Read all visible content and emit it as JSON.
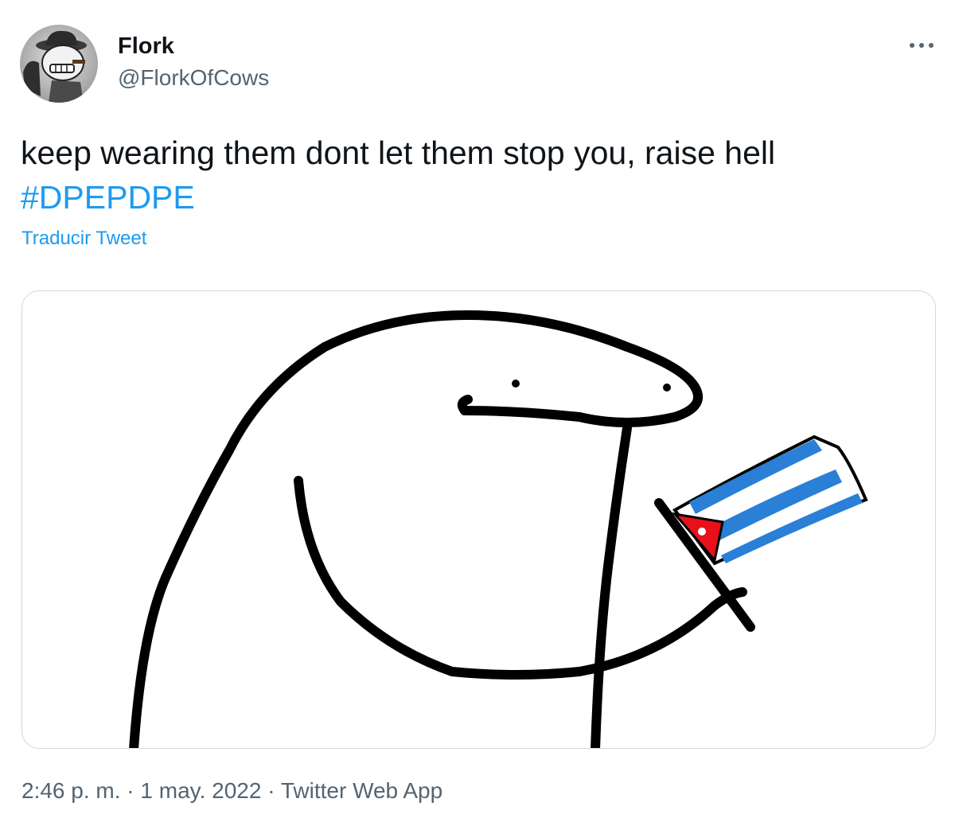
{
  "tweet": {
    "author": {
      "name": "Flork",
      "handle": "@FlorkOfCows"
    },
    "text": "keep wearing them dont let them stop you, raise hell",
    "hashtag": "#DPEPDPE",
    "translate_label": "Traducir Tweet",
    "more_label": "···",
    "meta": {
      "time": "2:46 p. m.",
      "separator": " · ",
      "date": "1 may. 2022",
      "source": "Twitter Web App"
    }
  },
  "colors": {
    "link": "#1d9bf0",
    "secondary_text": "#536471",
    "primary_text": "#0f1419",
    "border": "#cfd9de",
    "flag_blue": "#2a7fd6",
    "flag_red": "#e8111b"
  },
  "icons": {
    "more": "more-horizontal-icon",
    "avatar": "avatar-image"
  }
}
